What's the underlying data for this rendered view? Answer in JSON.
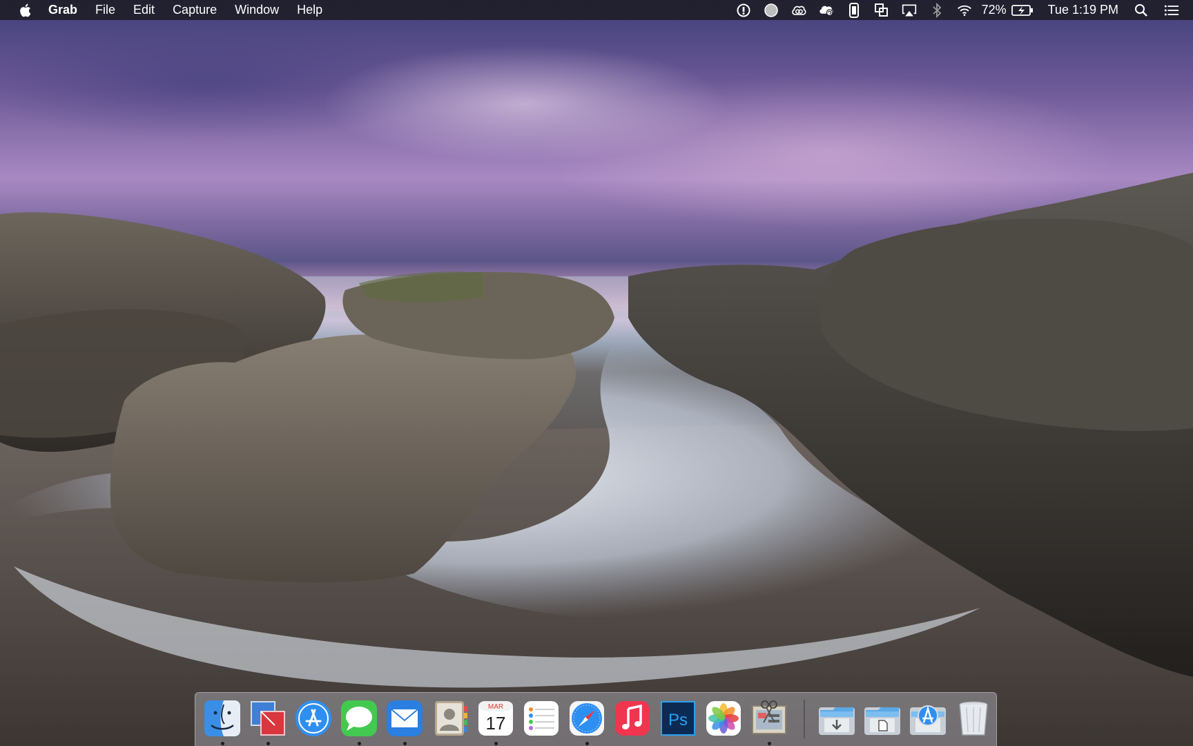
{
  "menubar": {
    "app_name": "Grab",
    "menus": [
      "File",
      "Edit",
      "Capture",
      "Window",
      "Help"
    ],
    "battery_percent": "72%",
    "clock": "Tue 1:19 PM",
    "status_icons": [
      "info-circle-icon",
      "record-circle-icon",
      "creative-cloud-icon",
      "cloud-sync-icon",
      "phone-icon",
      "screens-icon",
      "airplay-icon",
      "bluetooth-icon",
      "wifi-icon",
      "battery-charging-icon",
      "spotlight-search-icon",
      "notification-center-icon"
    ]
  },
  "dock": {
    "apps": [
      {
        "name": "finder",
        "running": true
      },
      {
        "name": "parallels",
        "running": true
      },
      {
        "name": "app-store",
        "running": false
      },
      {
        "name": "messages",
        "running": true
      },
      {
        "name": "mail",
        "running": true
      },
      {
        "name": "contacts",
        "running": false
      },
      {
        "name": "calendar",
        "running": true
      },
      {
        "name": "reminders",
        "running": false
      },
      {
        "name": "safari",
        "running": true
      },
      {
        "name": "itunes",
        "running": false
      },
      {
        "name": "photoshop",
        "running": false
      },
      {
        "name": "photos",
        "running": false
      },
      {
        "name": "grab",
        "running": true
      }
    ],
    "calendar": {
      "month": "MAR",
      "day": "17"
    },
    "photoshop_label": "Ps",
    "stacks": [
      "downloads-stack",
      "documents-stack",
      "applications-stack",
      "trash"
    ],
    "colors": {
      "finder": "#3a8ee6",
      "messages": "#43c94f",
      "mail": "#2a7fe0",
      "itunes": "#f0364f",
      "photoshop": "#0d2a52",
      "app_store": "#2f8ff0"
    }
  }
}
